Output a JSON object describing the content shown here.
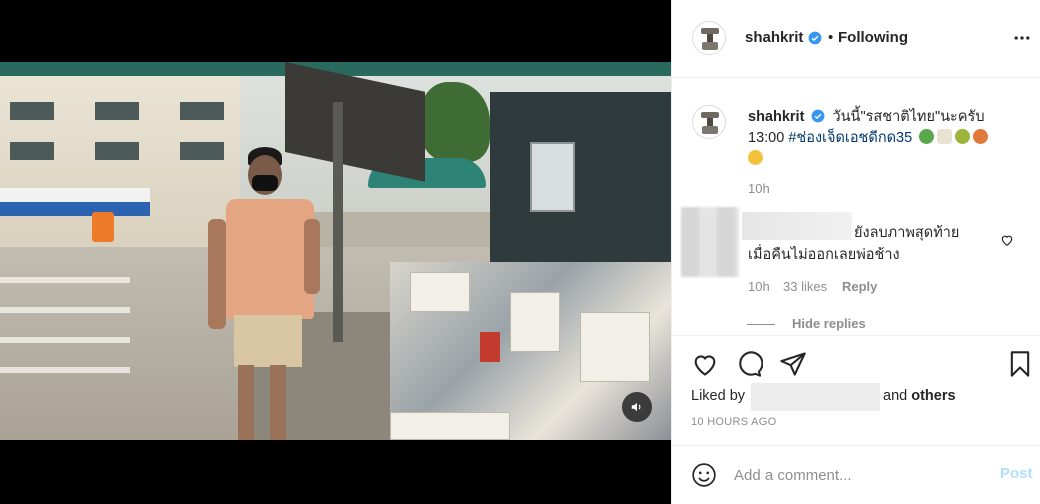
{
  "post": {
    "author": "shahkrit",
    "follow_status": "Following",
    "separator": "•"
  },
  "caption": {
    "username": "shahkrit",
    "line1": "วันนี้\"รสชาติไทย\"นะครับ",
    "line2_time": "13:00",
    "hashtag": "#ช่องเจ็ดเอชดีกด35",
    "age": "10h",
    "emoji_icons": [
      "salad-emoji-icon",
      "noodles-emoji-icon",
      "pie-emoji-icon",
      "dish-emoji-icon",
      "pointing-hand-emoji-icon"
    ]
  },
  "reply": {
    "line1": "ยังลบภาพสุดท้าย",
    "line2": "เมื่อคืนไม่ออกเลยพ่อช้าง",
    "age": "10h",
    "likes": "33 likes",
    "reply_label": "Reply",
    "hide_replies": "Hide replies"
  },
  "actions": {
    "liked_by": "Liked by",
    "and": "and",
    "others": "others",
    "timestamp": "10 HOURS AGO"
  },
  "comment_box": {
    "placeholder": "Add a comment...",
    "post_label": "Post"
  },
  "colors": {
    "verified_blue": "#3897f0",
    "hashtag_blue": "#00376b",
    "muted_gray": "#8e8e8e",
    "post_disabled": "#b2dffc"
  },
  "icons": {
    "more": "more-options-icon",
    "like": "heart-icon",
    "comment": "comment-icon",
    "share": "share-icon",
    "save": "bookmark-icon",
    "emoji": "emoji-smile-icon",
    "mute": "speaker-icon"
  }
}
